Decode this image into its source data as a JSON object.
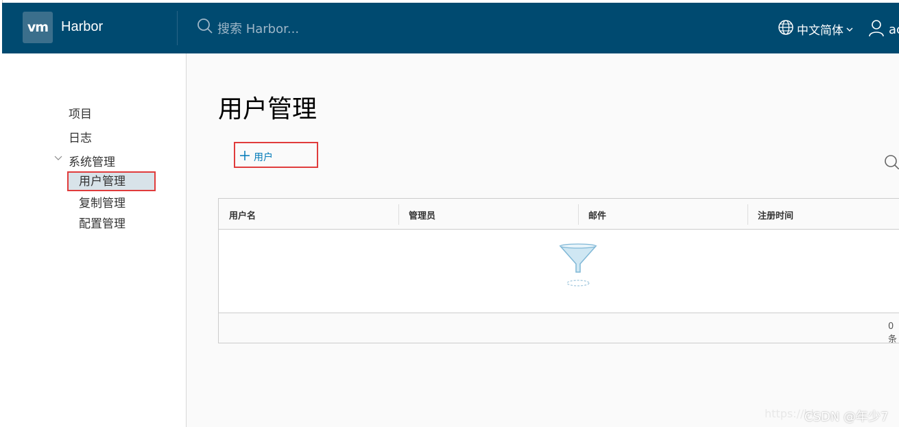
{
  "header": {
    "logo": "vm",
    "app_title": "Harbor",
    "search_placeholder": "搜索 Harbor...",
    "language": "中文简体",
    "user": "ac"
  },
  "sidebar": {
    "items": [
      {
        "label": "项目"
      },
      {
        "label": "日志"
      },
      {
        "label": "系统管理"
      }
    ],
    "sub_items": [
      {
        "label": "用户管理"
      },
      {
        "label": "复制管理"
      },
      {
        "label": "配置管理"
      }
    ]
  },
  "main": {
    "title": "用户管理",
    "add_user": "用户",
    "table": {
      "columns": [
        "用户名",
        "管理员",
        "邮件",
        "注册时间"
      ],
      "footer_count": "0 条"
    }
  },
  "watermark": {
    "url": "https://bl",
    "csdn": "CSDN @年少7"
  },
  "colors": {
    "header_bg": "#004a70",
    "accent": "#0079b8",
    "highlight_border": "#e03b3b"
  }
}
